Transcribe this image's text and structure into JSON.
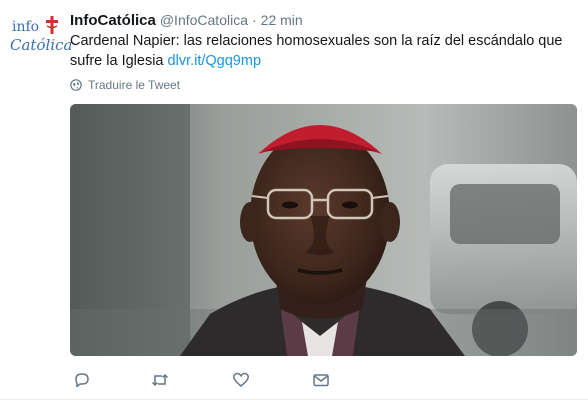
{
  "account": {
    "name": "InfoCatólica",
    "handle": "@InfoCatolica",
    "separator": "·",
    "time": "22 min",
    "avatar_top": "info",
    "avatar_bottom": "Católica"
  },
  "tweet": {
    "text": "Cardenal Napier: las relaciones homosexuales son la raíz del escándalo que sufre la Iglesia",
    "link": "dlvr.it/Qgq9mp"
  },
  "translate_label": "Traduire le Tweet",
  "actions": [
    {
      "icon": "reply-icon"
    },
    {
      "icon": "retweet-icon"
    },
    {
      "icon": "like-icon"
    },
    {
      "icon": "message-icon"
    }
  ],
  "colors": {
    "link": "#1b95e0",
    "muted": "#657786",
    "text": "#14171a",
    "brand": "#3b6fb6"
  }
}
